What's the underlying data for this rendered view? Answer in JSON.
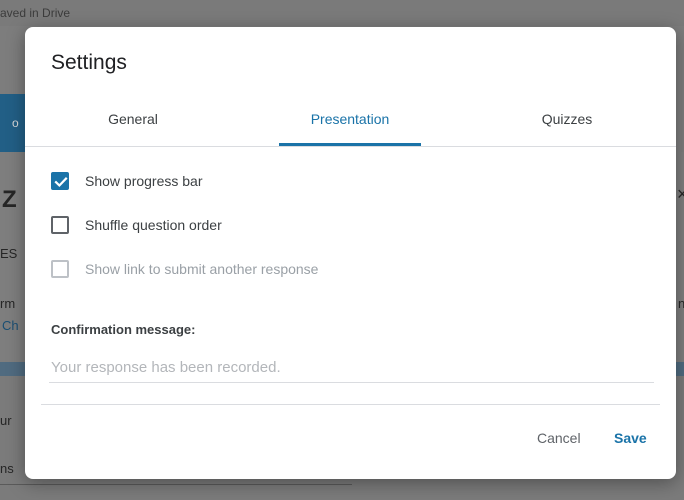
{
  "background": {
    "saved_text": "aved in Drive",
    "banner_letter": "o",
    "left_letters": [
      "Z",
      "ES",
      "rm",
      "Ch",
      "ur",
      "ns"
    ],
    "right_letters": [
      "×",
      "n"
    ]
  },
  "dialog": {
    "title": "Settings",
    "tabs": [
      {
        "label": "General",
        "active": false
      },
      {
        "label": "Presentation",
        "active": true
      },
      {
        "label": "Quizzes",
        "active": false
      }
    ],
    "options": [
      {
        "label": "Show progress bar",
        "checked": true,
        "disabled": false
      },
      {
        "label": "Shuffle question order",
        "checked": false,
        "disabled": false
      },
      {
        "label": "Show link to submit another response",
        "checked": false,
        "disabled": true
      }
    ],
    "confirmation_label": "Confirmation message:",
    "confirmation_placeholder": "Your response has been recorded.",
    "confirmation_value": "",
    "cancel_label": "Cancel",
    "save_label": "Save"
  },
  "colors": {
    "accent": "#1a73a8",
    "overlay": "#7d7d7d"
  }
}
